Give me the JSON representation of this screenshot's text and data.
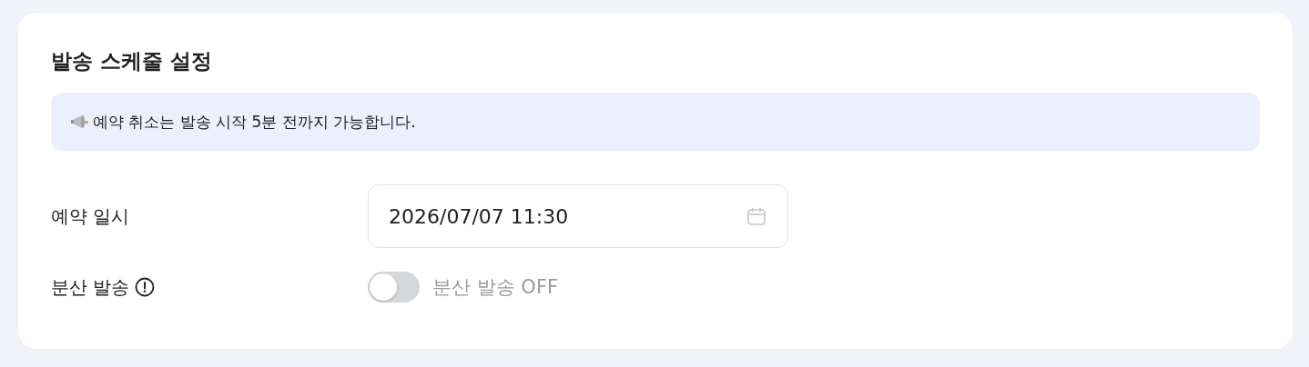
{
  "section": {
    "title": "발송 스케줄 설정"
  },
  "notice": {
    "text": "예약 취소는 발송 시작 5분 전까지 가능합니다."
  },
  "schedule": {
    "label": "예약 일시",
    "value": "2026/07/07 11:30"
  },
  "distributed": {
    "label": "분산 발송",
    "on": false,
    "status": "분산 발송 OFF"
  }
}
